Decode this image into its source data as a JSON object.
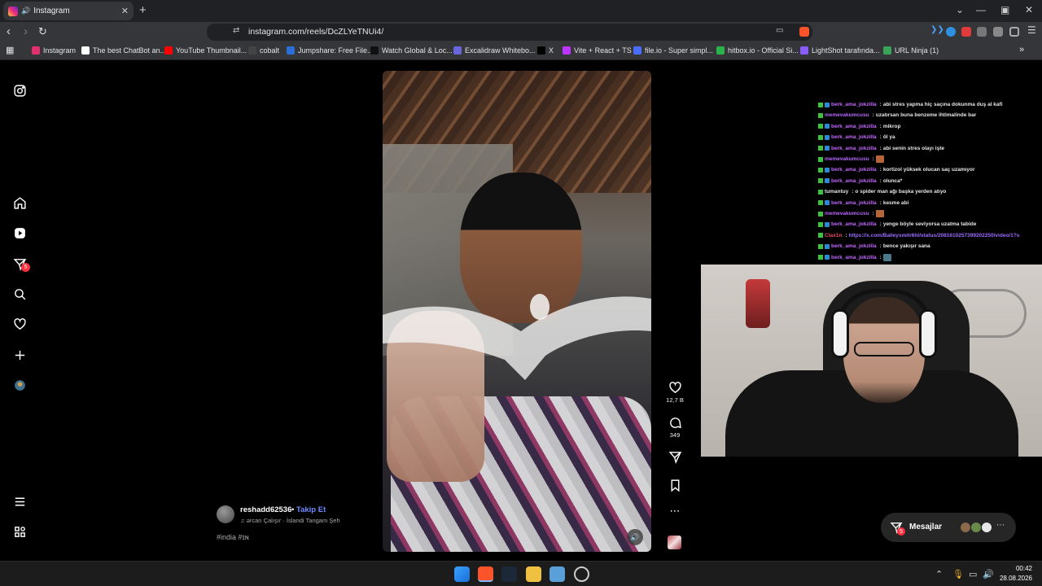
{
  "browser": {
    "tab": {
      "title": "Instagram"
    },
    "url": "instagram.com/reels/DcZLYeTNUi4/",
    "bookmarks": [
      "Instagram",
      "The best ChatBot an...",
      "YouTube Thumbnail...",
      "cobalt",
      "Jumpshare: Free File...",
      "Watch Global & Loc...",
      "Excalidraw Whitebo...",
      "X",
      "Vite + React + TS",
      "file.io - Super simpl...",
      "hitbox.io - Official Si...",
      "LightShot tarafında...",
      "URL Ninja (1)"
    ],
    "bookmark_colors": [
      "#e1306c",
      "#ffffff",
      "#ff0000",
      "#444444",
      "#2a6fd6",
      "#111111",
      "#6965db",
      "#000000",
      "#bd34fe",
      "#4a6cff",
      "#2bb24c",
      "#8a5cff",
      "#3aa35a"
    ]
  },
  "instagram": {
    "sidebar": {
      "icons": [
        "instagram-logo-icon",
        "home-icon",
        "reels-icon",
        "direct-icon",
        "search-icon",
        "heart-icon",
        "create-icon",
        "profile-avatar-icon",
        "menu-icon",
        "apps-icon"
      ],
      "notification_count": "5"
    },
    "reel": {
      "author": "reshadd62536",
      "follow_label": "Takip Et",
      "separator": "•",
      "music": "ərcan Çalışır · İslandi Tangam Şeh",
      "hashtags": "#india #ɪɴ",
      "likes": "12,7 B",
      "comments": "349"
    },
    "messages": {
      "label": "Mesajlar",
      "badge": "5"
    }
  },
  "stream": {
    "chat": [
      {
        "user": "berk_ama_jokzilla",
        "color": "#c467ff",
        "badges": 2,
        "text": "abi stres yapma hiç saçına dokunma duş al kafi"
      },
      {
        "user": "memevakumcusu",
        "color": "#b766ff",
        "badges": 1,
        "text": "uzatırsan buna benzeme ihtimalinde bar"
      },
      {
        "user": "berk_ama_jokzilla",
        "color": "#c467ff",
        "badges": 2,
        "text": "mikrop"
      },
      {
        "user": "berk_ama_jokzilla",
        "color": "#c467ff",
        "badges": 2,
        "text": "öl ya"
      },
      {
        "user": "berk_ama_jokzilla",
        "color": "#c467ff",
        "badges": 2,
        "text": "abi senin stres olayı işte"
      },
      {
        "user": "memevakumcusu",
        "color": "#b766ff",
        "badges": 1,
        "text": "",
        "emote": "#b5653a"
      },
      {
        "user": "berk_ama_jokzilla",
        "color": "#c467ff",
        "badges": 2,
        "text": "kortizol yüksek olucan saç uzamıyor"
      },
      {
        "user": "berk_ama_jokzilla",
        "color": "#c467ff",
        "badges": 2,
        "text": "olunca*"
      },
      {
        "user": "tumantuy",
        "color": "#e6e6e6",
        "badges": 1,
        "text": "o spider man ağı başka yerden atıyo"
      },
      {
        "user": "berk_ama_jokzilla",
        "color": "#c467ff",
        "badges": 2,
        "text": "kesme abi"
      },
      {
        "user": "memevakumcusu",
        "color": "#b766ff",
        "badges": 1,
        "text": "",
        "emote": "#b5653a"
      },
      {
        "user": "berk_ama_jokzilla",
        "color": "#c467ff",
        "badges": 2,
        "text": "yenge böyle seviyorsa uzatma tabide"
      },
      {
        "user": "Clax1n",
        "color": "#e84a5f",
        "badges": 1,
        "text": "",
        "link": "https://x.com/Balleysmitr6hl/status/2081610257399202250/video/1?s"
      },
      {
        "user": "berk_ama_jokzilla",
        "color": "#c467ff",
        "badges": 2,
        "text": "bence yakışır sana"
      },
      {
        "user": "berk_ama_jokzilla",
        "color": "#c467ff",
        "badges": 2,
        "text": "",
        "emote": "#4a7a8a"
      }
    ]
  },
  "taskbar": {
    "time": "00:42",
    "date": "28.08.2026"
  }
}
